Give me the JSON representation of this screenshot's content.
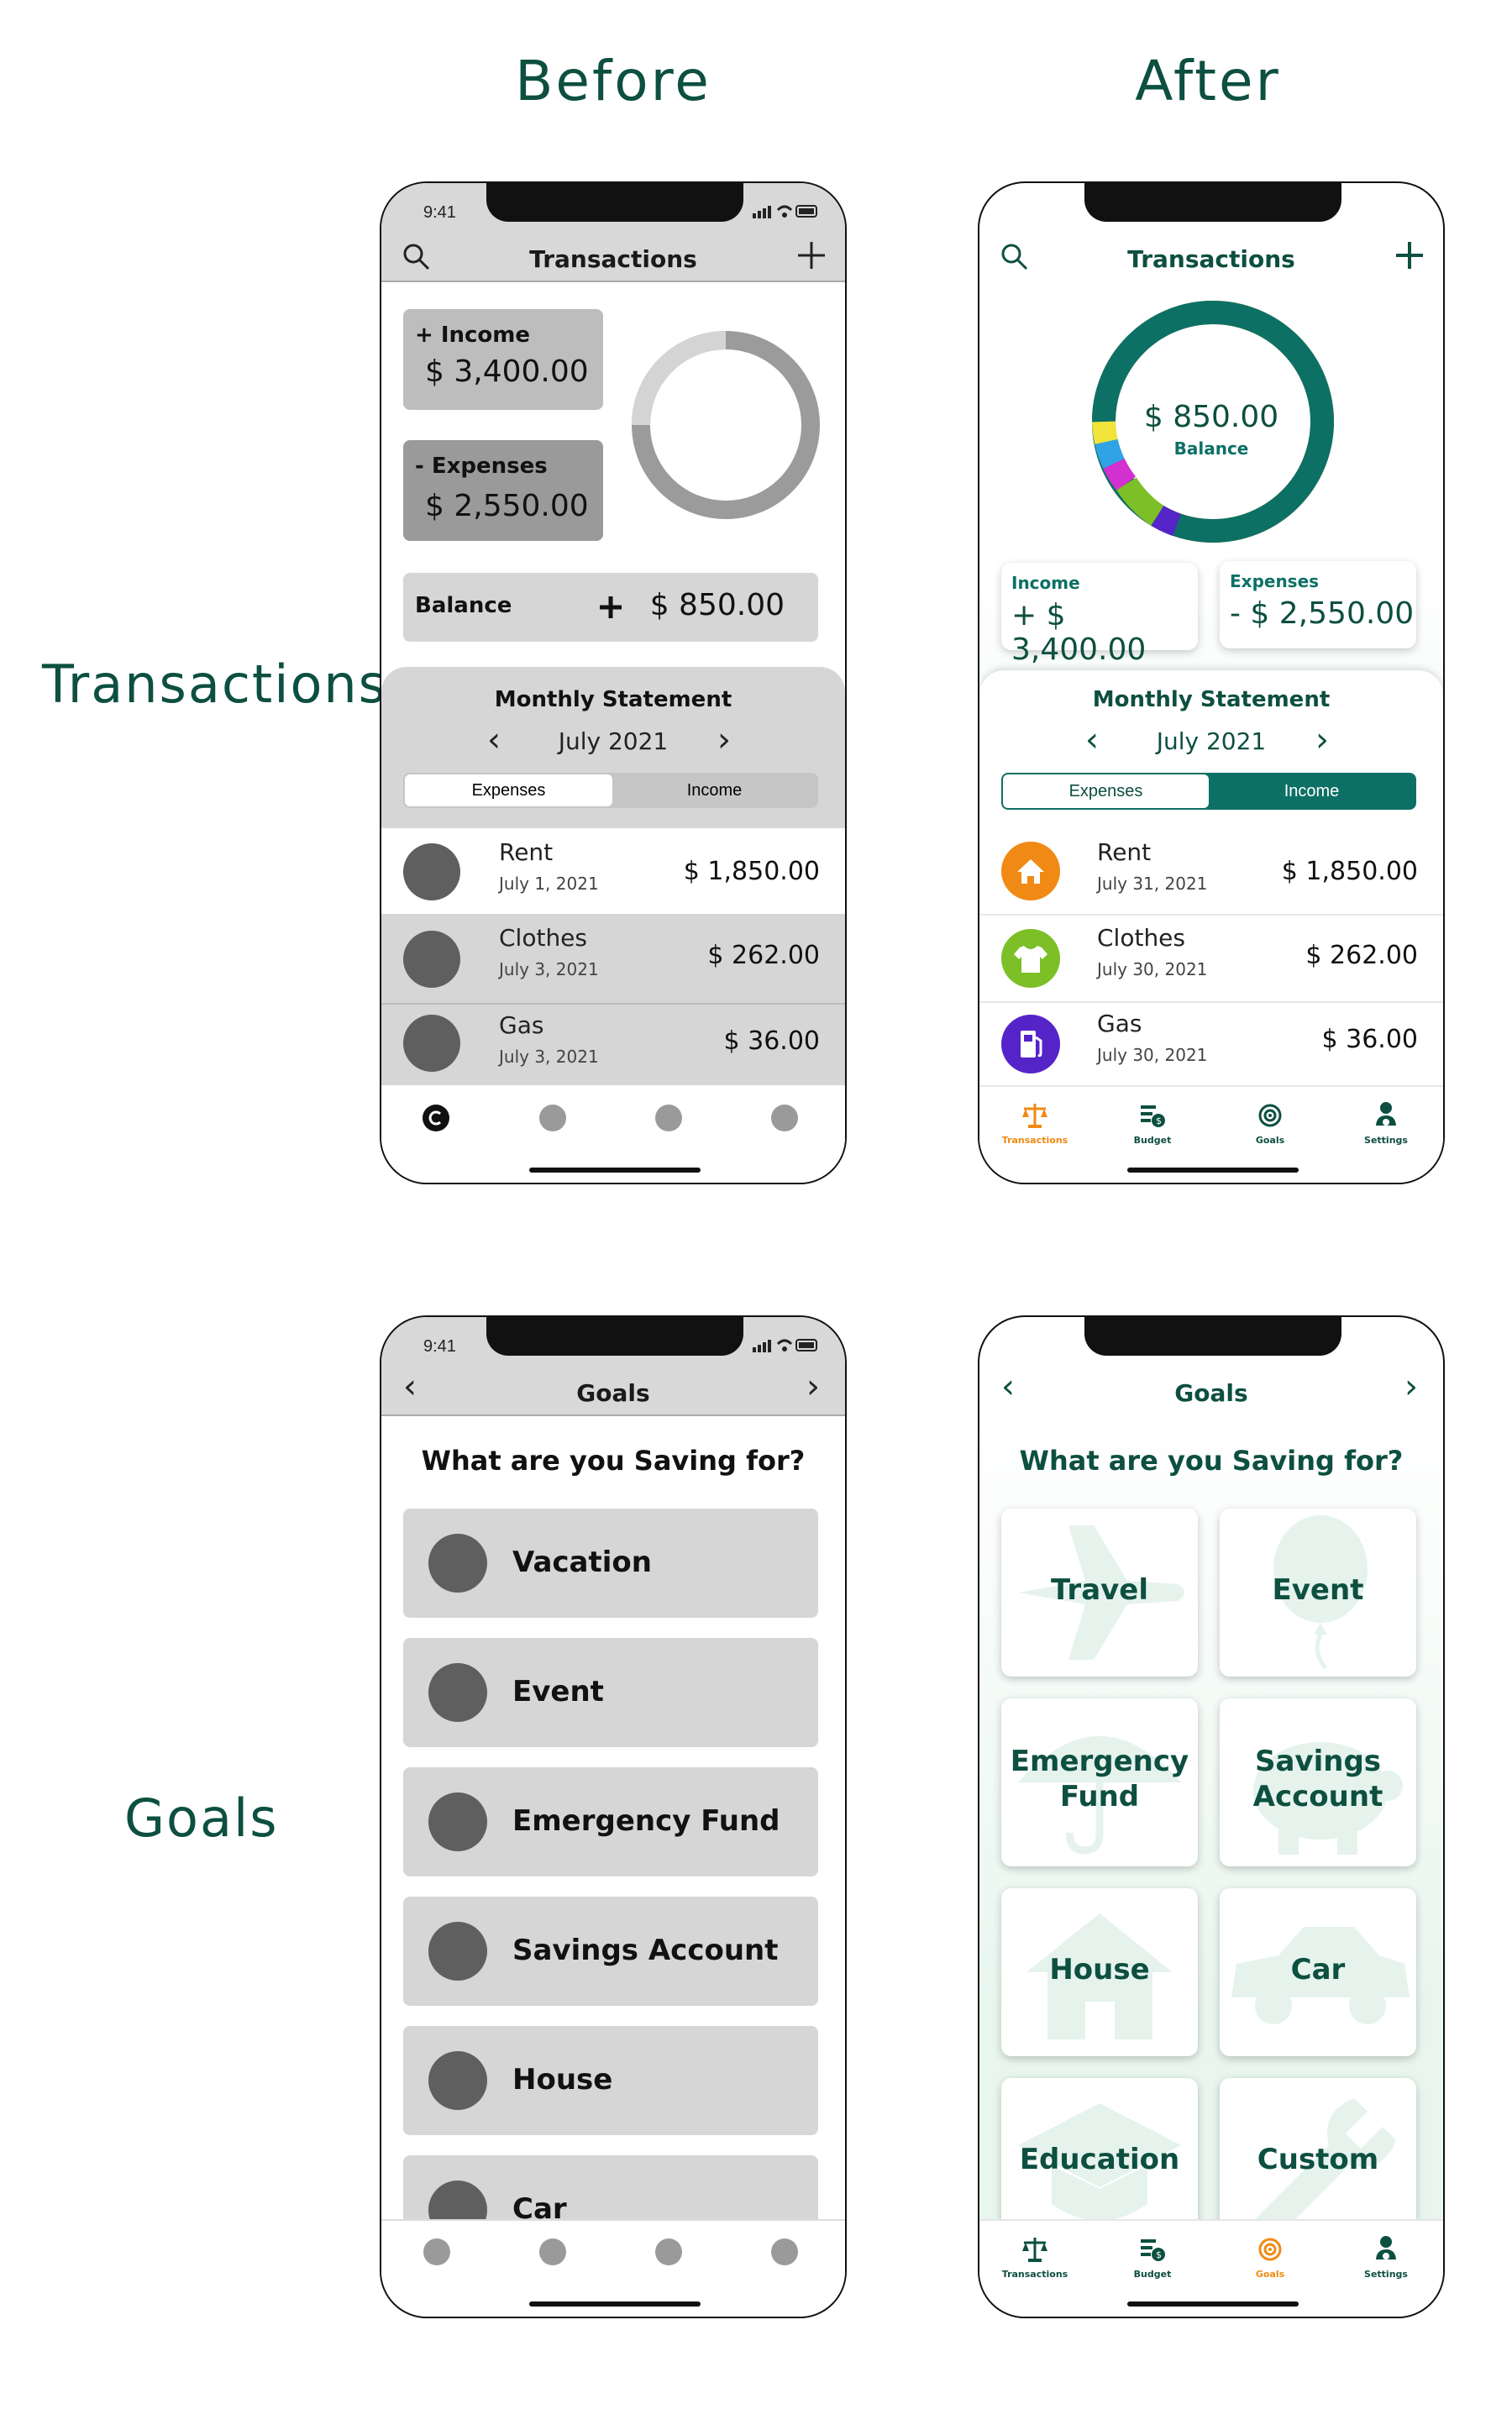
{
  "columns": {
    "before": "Before",
    "after": "After"
  },
  "rows": {
    "transactions": "Transactions",
    "goals": "Goals"
  },
  "status": {
    "time": "9:41"
  },
  "colors": {
    "brand_green": "#0d4f40",
    "teal": "#0d7065",
    "orange": "#f08a14",
    "gray": "#d8d8d8"
  },
  "tx_before": {
    "title": "Transactions",
    "income_label": "+ Income",
    "income_value": "$ 3,400.00",
    "expenses_label": "- Expenses",
    "expenses_value": "$ 2,550.00",
    "balance_label": "Balance",
    "balance_value": "$ 850.00",
    "statement_title": "Monthly Statement",
    "month": "July 2021",
    "seg_expenses": "Expenses",
    "seg_income": "Income",
    "rows": [
      {
        "name": "Rent",
        "date": "July 1, 2021",
        "amount": "$ 1,850.00"
      },
      {
        "name": "Clothes",
        "date": "July 3, 2021",
        "amount": "$ 262.00"
      },
      {
        "name": "Gas",
        "date": "July 3, 2021",
        "amount": "$ 36.00"
      }
    ]
  },
  "tx_after": {
    "title": "Transactions",
    "balance_value": "$ 850.00",
    "balance_label": "Balance",
    "income_label": "Income",
    "income_value": "+ $ 3,400.00",
    "expenses_label": "Expenses",
    "expenses_value": "- $ 2,550.00",
    "statement_title": "Monthly Statement",
    "month": "July 2021",
    "seg_expenses": "Expenses",
    "seg_income": "Income",
    "rows": [
      {
        "name": "Rent",
        "date": "July 31, 2021",
        "amount": "$ 1,850.00",
        "icon": "house-icon",
        "color": "#f08a14"
      },
      {
        "name": "Clothes",
        "date": "July 30, 2021",
        "amount": "$ 262.00",
        "icon": "shirt-icon",
        "color": "#7cbf27"
      },
      {
        "name": "Gas",
        "date": "July 30, 2021",
        "amount": "$ 36.00",
        "icon": "fuel-pump-icon",
        "color": "#5424c9"
      }
    ],
    "nav": [
      "Transactions",
      "Budget",
      "Goals",
      "Settings"
    ]
  },
  "goals_before": {
    "title": "Goals",
    "question": "What are you Saving for?",
    "items": [
      "Vacation",
      "Event",
      "Emergency Fund",
      "Savings Account",
      "House",
      "Car"
    ]
  },
  "goals_after": {
    "title": "Goals",
    "question": "What are you Saving for?",
    "items": [
      "Travel",
      "Event",
      "Emergency Fund",
      "Savings Account",
      "House",
      "Car",
      "Education",
      "Custom"
    ],
    "nav": [
      "Transactions",
      "Budget",
      "Goals",
      "Settings"
    ]
  }
}
